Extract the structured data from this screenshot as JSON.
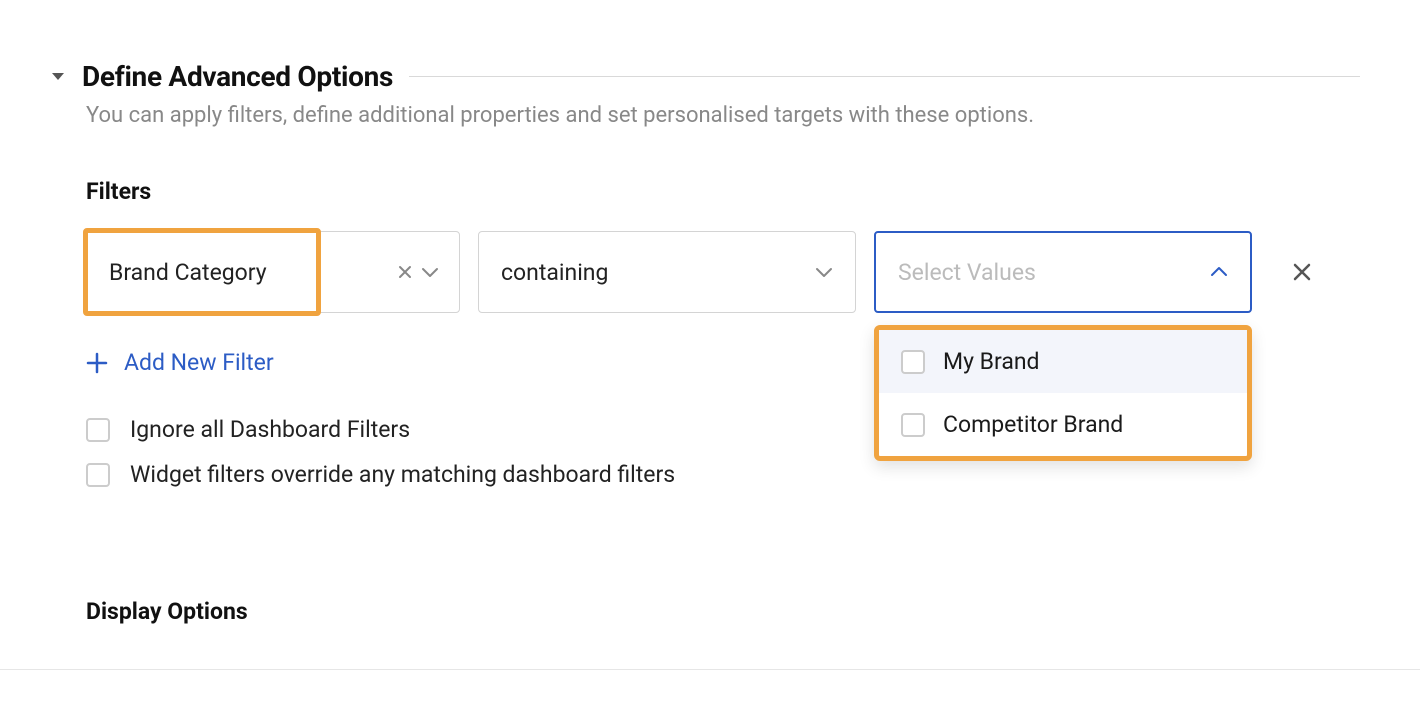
{
  "section": {
    "title": "Define Advanced Options",
    "subtitle": "You can apply filters, define additional properties and set personalised targets with these options."
  },
  "filters": {
    "label": "Filters",
    "row": {
      "category": "Brand Category",
      "operator": "containing",
      "values_placeholder": "Select Values",
      "options": [
        {
          "label": "My Brand",
          "checked": false
        },
        {
          "label": "Competitor Brand",
          "checked": false
        }
      ]
    },
    "add_new_label": "Add New Filter",
    "dashboard_options": [
      {
        "label": "Ignore all Dashboard Filters",
        "checked": false
      },
      {
        "label": "Widget filters override any matching dashboard filters",
        "checked": false
      }
    ]
  },
  "display": {
    "label": "Display Options"
  }
}
